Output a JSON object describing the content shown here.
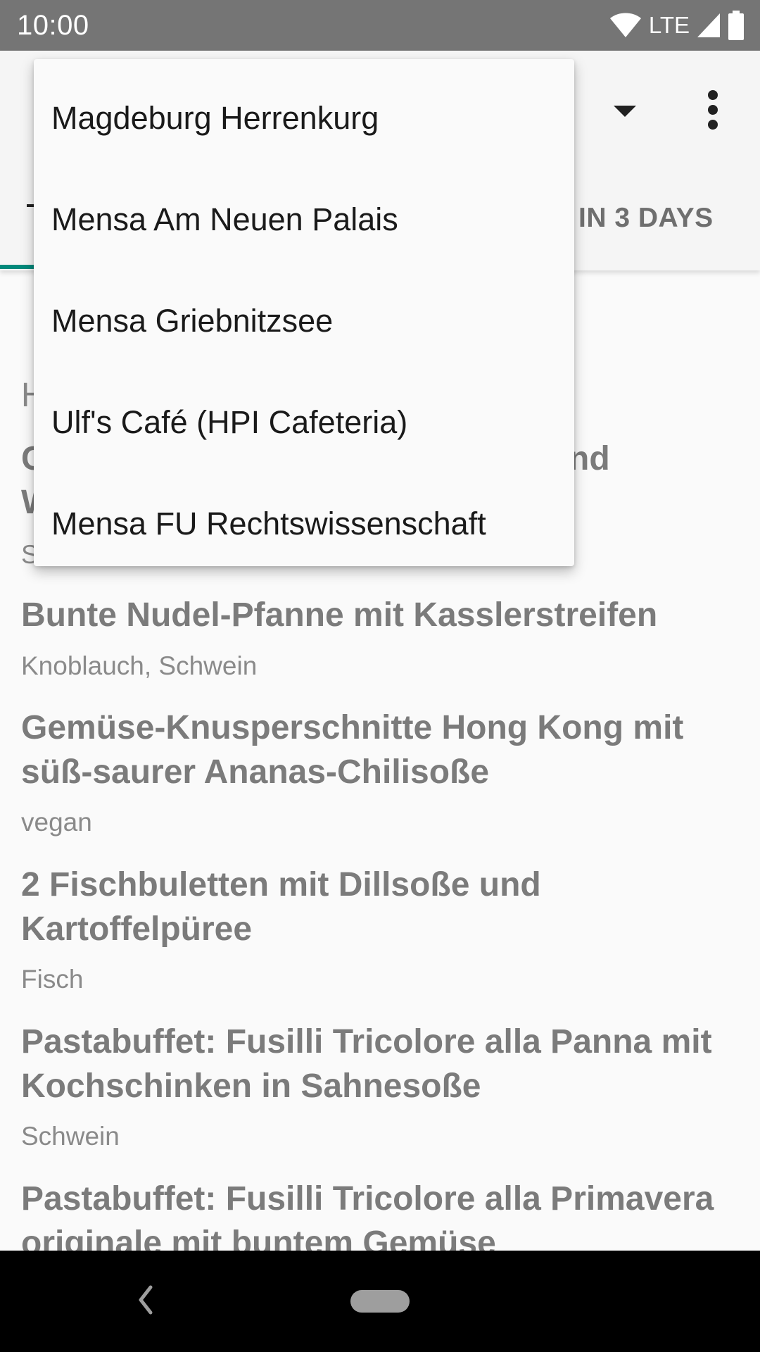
{
  "status_bar": {
    "time": "10:00",
    "network_label": "LTE",
    "icons": [
      "wifi-icon",
      "signal-icon",
      "battery-icon"
    ]
  },
  "toolbar": {
    "icons": [
      "dropdown-arrow-icon",
      "more-vert-icon"
    ]
  },
  "tabs": {
    "visible_tab_label": "IN 3 DAYS",
    "indicator_color": "#00897b"
  },
  "dropdown": {
    "items": [
      "Magdeburg Herrenkurg",
      "Mensa Am Neuen Palais",
      "Mensa Griebnitzsee",
      "Ulf's Café (HPI Cafeteria)",
      "Mensa FU Rechtswissenschaft"
    ]
  },
  "meals": [
    {
      "name": "Bunte Nudel-Pfanne mit Kasslerstreifen",
      "tags": "Knoblauch, Schwein"
    },
    {
      "name": "Gemüse-Knusperschnitte Hong Kong mit süß-saurer Ananas-Chilisoße",
      "tags": "vegan"
    },
    {
      "name": "2 Fischbuletten mit Dillsoße und Kartoffelpüree",
      "tags": "Fisch"
    },
    {
      "name": "Pastabuffet: Fusilli Tricolore alla Panna mit Kochschinken in Sahnesoße",
      "tags": "Schwein"
    },
    {
      "name": "Pastabuffet: Fusilli Tricolore alla Primavera originale mit buntem Gemüse",
      "tags": ""
    }
  ],
  "partial_text": {
    "hidden_heading_fragment": "H",
    "hidden_meal_fragment_1": "C",
    "hidden_meal_fragment_1_end": "nd",
    "hidden_meal_fragment_2": "W",
    "hidden_tags_fragment": "S"
  }
}
